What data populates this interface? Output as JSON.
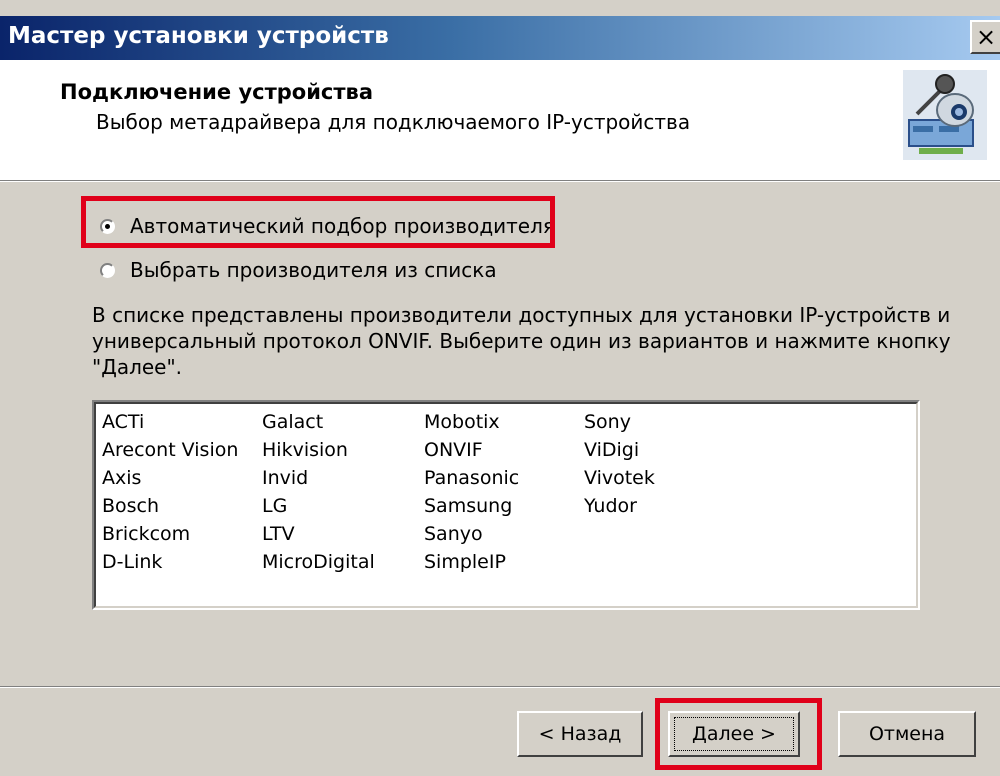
{
  "window": {
    "title": "Мастер установки устройств"
  },
  "header": {
    "title": "Подключение устройства",
    "subtitle": "Выбор метадрайвера для подключаемого IP-устройства"
  },
  "options": {
    "auto_label": "Автоматический подбор производителя",
    "auto_selected": true,
    "manual_label": "Выбрать производителя из списка",
    "manual_selected": false
  },
  "description": "В списке представлены производители доступных для установки IP-устройств и универсальный протокол ONVIF. Выберите один из вариантов и нажмите кнопку \"Далее\".",
  "vendors": [
    [
      "ACTi",
      "Arecont Vision",
      "Axis",
      "Bosch",
      "Brickcom",
      "D-Link"
    ],
    [
      "Galact",
      "Hikvision",
      "Invid",
      "LG",
      "LTV",
      "MicroDigital"
    ],
    [
      "Mobotix",
      "ONVIF",
      "Panasonic",
      "Samsung",
      "Sanyo",
      "SimpleIP"
    ],
    [
      "Sony",
      "ViDigi",
      "Vivotek",
      "Yudor"
    ]
  ],
  "buttons": {
    "back": "< Назад",
    "next": "Далее >",
    "cancel": "Отмена",
    "close": "×"
  },
  "colors": {
    "highlight": "#e0001a",
    "titlebar_start": "#0a246a",
    "titlebar_end": "#a6caf0",
    "dialog_bg": "#d4d0c8"
  }
}
